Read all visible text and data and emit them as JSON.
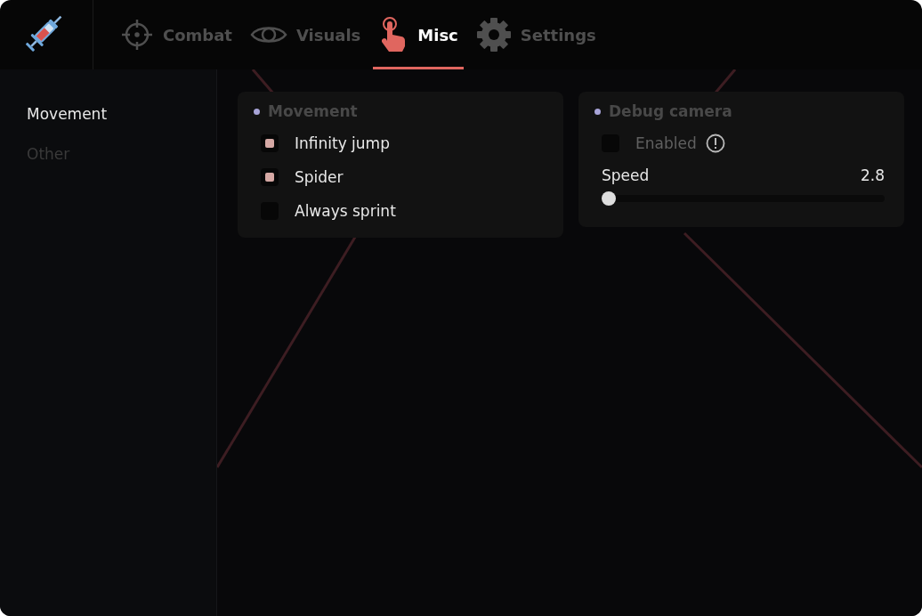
{
  "tabs": [
    {
      "label": "Combat",
      "kind": "crosshair",
      "selected": false
    },
    {
      "label": "Visuals",
      "kind": "eye",
      "selected": false
    },
    {
      "label": "Misc",
      "kind": "hand",
      "selected": true
    },
    {
      "label": "Settings",
      "kind": "gear",
      "selected": false
    }
  ],
  "sidebar": {
    "items": [
      {
        "label": "Movement",
        "selected": true
      },
      {
        "label": "Other",
        "selected": false
      }
    ]
  },
  "panels": [
    {
      "title": "Movement",
      "rows": [
        {
          "kind": "checkbox",
          "label": "Infinity jump",
          "checked": true
        },
        {
          "kind": "checkbox",
          "label": "Spider",
          "checked": true
        },
        {
          "kind": "checkbox",
          "label": "Always sprint",
          "checked": false
        }
      ]
    },
    {
      "title": "Debug camera",
      "rows": [
        {
          "kind": "checkbox",
          "label": "Enabled",
          "checked": false,
          "disabled": true,
          "info": true
        },
        {
          "kind": "slider",
          "label": "Speed",
          "reading": "2.8",
          "level": 0.0
        }
      ]
    }
  ]
}
